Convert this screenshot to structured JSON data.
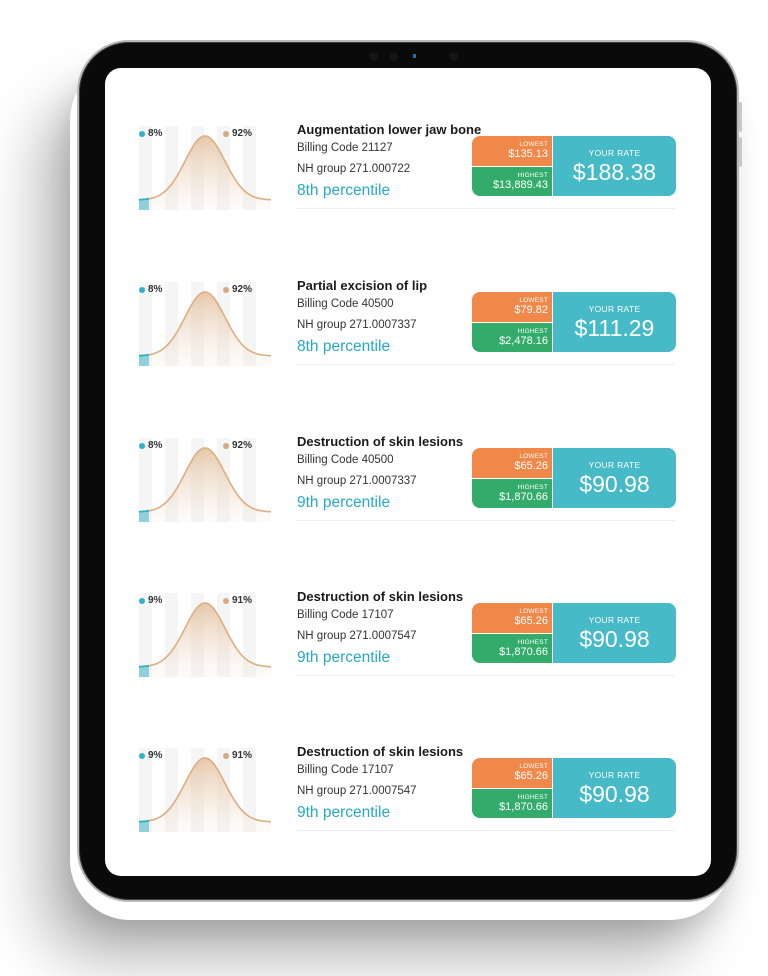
{
  "colors": {
    "percentile_text": "#27a9c4",
    "lowest_bg": "#f0884a",
    "highest_bg": "#33ac6b",
    "your_rate_bg": "#46bac7",
    "curve_stroke": "#dcae82",
    "low_marker": "#2bb3c8",
    "high_marker": "#d9aa82"
  },
  "labels": {
    "lowest": "LOWEST",
    "highest": "HIGHEST",
    "your_rate": "YOUR RATE"
  },
  "procedures": [
    {
      "title": "Augmentation lower jaw bone",
      "billing_code": "Billing Code 21127",
      "nh_group": "NH group 271.000722",
      "percentile": "8th percentile",
      "low_pct": "8%",
      "high_pct": "92%",
      "lowest": "$135.13",
      "highest": "$13,889.43",
      "your_rate": "$188.38"
    },
    {
      "title": "Partial excision of lip",
      "billing_code": "Billing Code 40500",
      "nh_group": "NH group 271.0007337",
      "percentile": "8th percentile",
      "low_pct": "8%",
      "high_pct": "92%",
      "lowest": "$79.82",
      "highest": "$2,478.16",
      "your_rate": "$111.29"
    },
    {
      "title": "Destruction of skin lesions",
      "billing_code": "Billing Code 40500",
      "nh_group": "NH group 271.0007337",
      "percentile": "9th percentile",
      "low_pct": "8%",
      "high_pct": "92%",
      "lowest": "$65.26",
      "highest": "$1,870.66",
      "your_rate": "$90.98"
    },
    {
      "title": "Destruction of skin lesions",
      "billing_code": "Billing Code 17107",
      "nh_group": "NH group 271.0007547",
      "percentile": "9th percentile",
      "low_pct": "9%",
      "high_pct": "91%",
      "lowest": "$65.26",
      "highest": "$1,870.66",
      "your_rate": "$90.98"
    },
    {
      "title": "Destruction of skin lesions",
      "billing_code": "Billing Code 17107",
      "nh_group": "NH group 271.0007547",
      "percentile": "9th percentile",
      "low_pct": "9%",
      "high_pct": "91%",
      "lowest": "$65.26",
      "highest": "$1,870.66",
      "your_rate": "$90.98"
    }
  ]
}
